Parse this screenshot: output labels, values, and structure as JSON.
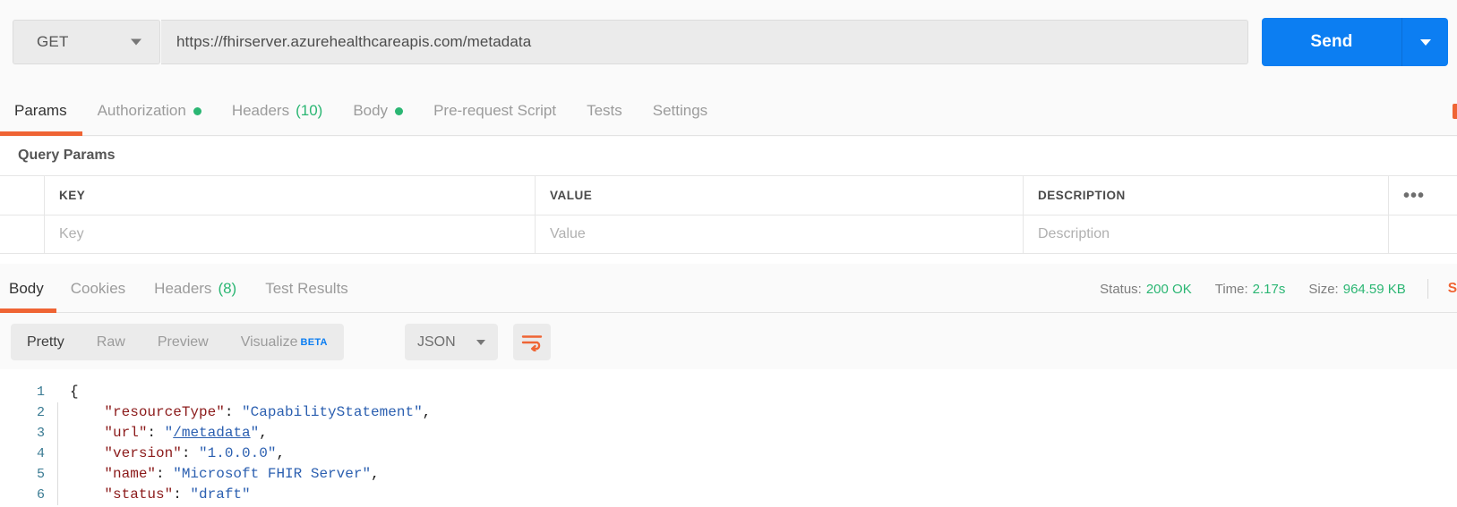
{
  "request": {
    "method": "GET",
    "url": "https://fhirserver.azurehealthcareapis.com/metadata",
    "send_label": "Send",
    "tabs": [
      {
        "label": "Params",
        "active": true,
        "dot": false,
        "count": ""
      },
      {
        "label": "Authorization",
        "active": false,
        "dot": true,
        "count": ""
      },
      {
        "label": "Headers",
        "active": false,
        "dot": false,
        "count": "(10)"
      },
      {
        "label": "Body",
        "active": false,
        "dot": true,
        "count": ""
      },
      {
        "label": "Pre-request Script",
        "active": false,
        "dot": false,
        "count": ""
      },
      {
        "label": "Tests",
        "active": false,
        "dot": false,
        "count": ""
      },
      {
        "label": "Settings",
        "active": false,
        "dot": false,
        "count": ""
      }
    ]
  },
  "query_params": {
    "title": "Query Params",
    "columns": [
      "KEY",
      "VALUE",
      "DESCRIPTION"
    ],
    "bulk_icon": "ellipsis-icon",
    "rows": [
      {
        "key": "Key",
        "value": "Value",
        "description": "Description"
      }
    ]
  },
  "response": {
    "tabs": [
      {
        "label": "Body",
        "active": true,
        "count": ""
      },
      {
        "label": "Cookies",
        "active": false,
        "count": ""
      },
      {
        "label": "Headers",
        "active": false,
        "count": "(8)"
      },
      {
        "label": "Test Results",
        "active": false,
        "count": ""
      }
    ],
    "meta": {
      "status_label": "Status:",
      "status_value": "200 OK",
      "time_label": "Time:",
      "time_value": "2.17s",
      "size_label": "Size:",
      "size_value": "964.59 KB",
      "save_label": "Save"
    },
    "view_modes": [
      {
        "label": "Pretty",
        "active": true,
        "badge": ""
      },
      {
        "label": "Raw",
        "active": false,
        "badge": ""
      },
      {
        "label": "Preview",
        "active": false,
        "badge": ""
      },
      {
        "label": "Visualize",
        "active": false,
        "badge": "BETA"
      }
    ],
    "format": "JSON",
    "wrap_icon": "wrap-text-icon",
    "code": {
      "language": "json",
      "lines": [
        {
          "n": "1",
          "indent": 0,
          "tokens": [
            {
              "t": "brace",
              "v": "{"
            }
          ]
        },
        {
          "n": "2",
          "indent": 1,
          "tokens": [
            {
              "t": "key",
              "v": "\"resourceType\""
            },
            {
              "t": "punct",
              "v": ": "
            },
            {
              "t": "str",
              "v": "\"CapabilityStatement\""
            },
            {
              "t": "punct",
              "v": ","
            }
          ]
        },
        {
          "n": "3",
          "indent": 1,
          "tokens": [
            {
              "t": "key",
              "v": "\"url\""
            },
            {
              "t": "punct",
              "v": ": "
            },
            {
              "t": "str",
              "v": "\""
            },
            {
              "t": "link",
              "v": "/metadata"
            },
            {
              "t": "str",
              "v": "\""
            },
            {
              "t": "punct",
              "v": ","
            }
          ]
        },
        {
          "n": "4",
          "indent": 1,
          "tokens": [
            {
              "t": "key",
              "v": "\"version\""
            },
            {
              "t": "punct",
              "v": ": "
            },
            {
              "t": "str",
              "v": "\"1.0.0.0\""
            },
            {
              "t": "punct",
              "v": ","
            }
          ]
        },
        {
          "n": "5",
          "indent": 1,
          "tokens": [
            {
              "t": "key",
              "v": "\"name\""
            },
            {
              "t": "punct",
              "v": ": "
            },
            {
              "t": "str",
              "v": "\"Microsoft FHIR Server\""
            },
            {
              "t": "punct",
              "v": ","
            }
          ]
        },
        {
          "n": "6",
          "indent": 1,
          "tokens": [
            {
              "t": "key",
              "v": "\"status\""
            },
            {
              "t": "punct",
              "v": ": "
            },
            {
              "t": "str",
              "v": "\"draft\""
            }
          ]
        }
      ]
    }
  },
  "colors": {
    "accent_orange": "#ef6434",
    "send_blue": "#0c7ef2",
    "success_green": "#2bb673",
    "beta_blue": "#0c7ef2",
    "json_key": "#8b1a1a",
    "json_string": "#2b5fb0",
    "line_number": "#3a7b93"
  }
}
